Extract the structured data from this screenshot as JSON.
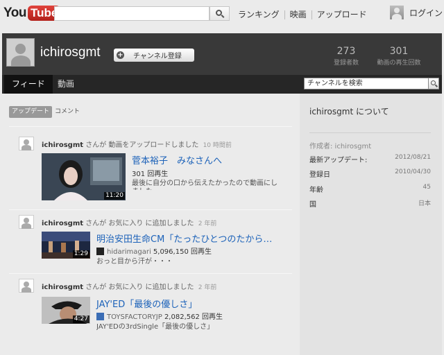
{
  "header": {
    "logo_you": "You",
    "logo_tube": "Tube",
    "search_placeholder": "",
    "nav": [
      "ランキング",
      "映画",
      "アップロード"
    ],
    "login": "ログイン"
  },
  "channel": {
    "name": "ichirosgmt",
    "subscribe_label": "チャンネル登録",
    "stats": [
      {
        "value": "273",
        "label": "登録者数"
      },
      {
        "value": "301",
        "label": "動画の再生回数"
      }
    ],
    "tabs": [
      "フィード",
      "動画"
    ],
    "search_placeholder": "チャンネルを検索"
  },
  "feed": {
    "filters": [
      "アップデート",
      "コメント"
    ],
    "items": [
      {
        "user": "ichirosgmt",
        "action": "さんが 動画をアップロードしました",
        "time": "10 時間前",
        "title": "菅本裕子　みなさんへ",
        "meta": "301 回再生",
        "desc": "最後に自分の口から伝えたかったので動画にし",
        "desc2": "ました",
        "duration": "11:20"
      },
      {
        "user": "ichirosgmt",
        "action": "さんが お気に入り に追加しました",
        "time": "2 年前",
        "title": "明治安田生命CM「たったひとつのたから…",
        "uploader": "hidarimagari",
        "views": "5,096,150",
        "views_label": "回再生",
        "desc": "おっと目から汗が・・・",
        "duration": "1:29"
      },
      {
        "user": "ichirosgmt",
        "action": "さんが お気に入り に追加しました",
        "time": "2 年前",
        "title": "JAY'ED「最後の優しさ」",
        "uploader": "TOYSFACTORYJP",
        "views": "2,082,562",
        "views_label": "回再生",
        "desc": "JAY'EDの3rdSingle「最後の優しさ」",
        "duration": "4:27"
      }
    ]
  },
  "about": {
    "title": "ichirosgmt について",
    "rows": [
      {
        "k": "作成者: ichirosgmt",
        "v": ""
      },
      {
        "k": "最新アップデート:",
        "v": "2012/08/21"
      },
      {
        "k": "登録日",
        "v": "2010/04/30"
      },
      {
        "k": "年齢",
        "v": "45"
      },
      {
        "k": "国",
        "v": "日本"
      }
    ]
  },
  "colors": {
    "accent": "#c4302b",
    "link": "#1c62b9",
    "channel_bar": "#393939"
  }
}
